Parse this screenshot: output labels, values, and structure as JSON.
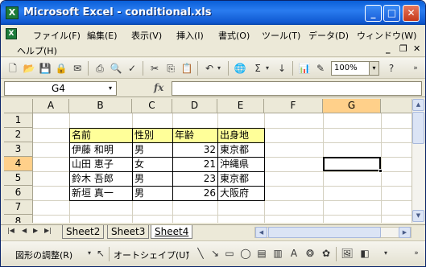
{
  "window": {
    "title": "Microsoft Excel - conditional.xls",
    "app_icon": "X"
  },
  "menu": {
    "items": [
      "ファイル(F)",
      "編集(E)",
      "表示(V)",
      "挿入(I)",
      "書式(O)",
      "ツール(T)",
      "データ(D)",
      "ウィンドウ(W)"
    ],
    "help": "ヘルプ(H)"
  },
  "toolbar": {
    "zoom": "100%",
    "autosum": "Σ",
    "fx": "fx"
  },
  "formula_bar": {
    "name_box": "G4",
    "formula": ""
  },
  "grid": {
    "columns": [
      "A",
      "B",
      "C",
      "D",
      "E",
      "F",
      "G"
    ],
    "rows": [
      "1",
      "2",
      "3",
      "4",
      "5",
      "6",
      "7",
      "8"
    ],
    "selected_cell": "G4",
    "table": {
      "headers": [
        "名前",
        "性別",
        "年齢",
        "出身地"
      ],
      "rows": [
        [
          "伊藤 和明",
          "男",
          "32",
          "東京都"
        ],
        [
          "山田 恵子",
          "女",
          "21",
          "沖縄県"
        ],
        [
          "鈴木 吾郎",
          "男",
          "23",
          "東京都"
        ],
        [
          "新垣 真一",
          "男",
          "26",
          "大阪府"
        ]
      ]
    },
    "header_color": "#ffff99"
  },
  "sheets": {
    "tabs": [
      "Sheet2",
      "Sheet3",
      "Sheet4"
    ],
    "active": "Sheet4"
  },
  "drawing_toolbar": {
    "draw_menu": "図形の調整(R)",
    "autoshapes": "オートシェイプ(U)"
  }
}
